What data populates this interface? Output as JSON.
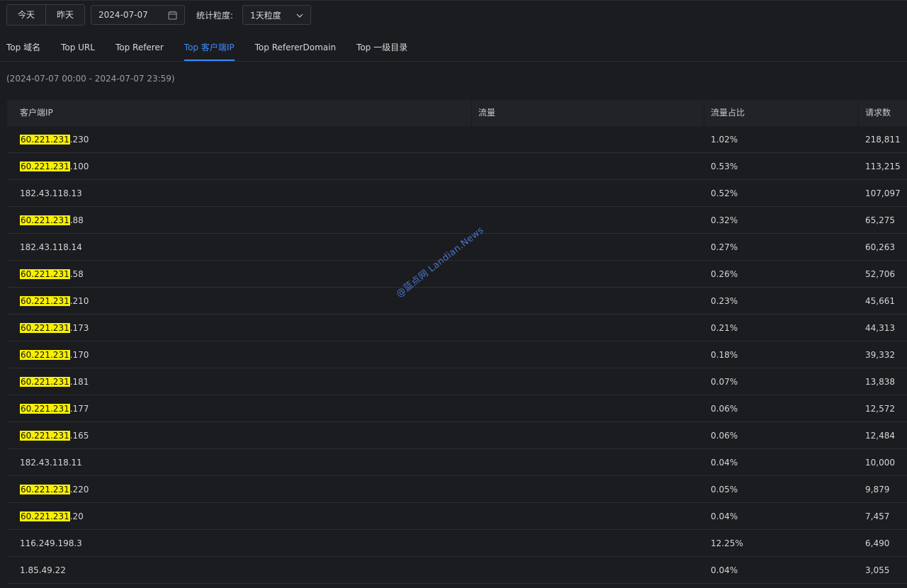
{
  "toolbar": {
    "today_label": "今天",
    "yesterday_label": "昨天",
    "date_value": "2024-07-07",
    "granularity_label": "统计粒度:",
    "granularity_value": "1天粒度"
  },
  "tabs": [
    {
      "label": "Top 域名",
      "active": false
    },
    {
      "label": "Top URL",
      "active": false
    },
    {
      "label": "Top Referer",
      "active": false
    },
    {
      "label": "Top 客户端IP",
      "active": true
    },
    {
      "label": "Top RefererDomain",
      "active": false
    },
    {
      "label": "Top 一级目录",
      "active": false
    }
  ],
  "range_text": "(2024-07-07 00:00 - 2024-07-07 23:59)",
  "table": {
    "headers": {
      "ip": "客户端IP",
      "flow": "流量",
      "pct": "流量占比",
      "req": "请求数"
    },
    "rows": [
      {
        "ip_prefix": "60.221.231",
        "ip_suffix": ".230",
        "flow": "",
        "pct": "1.02%",
        "req": "218,811"
      },
      {
        "ip_prefix": "60.221.231",
        "ip_suffix": ".100",
        "flow": "",
        "pct": "0.53%",
        "req": "113,215"
      },
      {
        "ip_prefix": "",
        "ip_suffix": "182.43.118.13",
        "flow": "",
        "pct": "0.52%",
        "req": "107,097"
      },
      {
        "ip_prefix": "60.221.231",
        "ip_suffix": ".88",
        "flow": "",
        "pct": "0.32%",
        "req": "65,275"
      },
      {
        "ip_prefix": "",
        "ip_suffix": "182.43.118.14",
        "flow": "",
        "pct": "0.27%",
        "req": "60,263"
      },
      {
        "ip_prefix": "60.221.231",
        "ip_suffix": ".58",
        "flow": "",
        "pct": "0.26%",
        "req": "52,706"
      },
      {
        "ip_prefix": "60.221.231",
        "ip_suffix": ".210",
        "flow": "",
        "pct": "0.23%",
        "req": "45,661"
      },
      {
        "ip_prefix": "60.221.231",
        "ip_suffix": ".173",
        "flow": "",
        "pct": "0.21%",
        "req": "44,313"
      },
      {
        "ip_prefix": "60.221.231",
        "ip_suffix": ".170",
        "flow": "",
        "pct": "0.18%",
        "req": "39,332"
      },
      {
        "ip_prefix": "60.221.231",
        "ip_suffix": ".181",
        "flow": "",
        "pct": "0.07%",
        "req": "13,838"
      },
      {
        "ip_prefix": "60.221.231",
        "ip_suffix": ".177",
        "flow": "",
        "pct": "0.06%",
        "req": "12,572"
      },
      {
        "ip_prefix": "60.221.231",
        "ip_suffix": ".165",
        "flow": "",
        "pct": "0.06%",
        "req": "12,484"
      },
      {
        "ip_prefix": "",
        "ip_suffix": "182.43.118.11",
        "flow": "",
        "pct": "0.04%",
        "req": "10,000"
      },
      {
        "ip_prefix": "60.221.231",
        "ip_suffix": ".220",
        "flow": "",
        "pct": "0.05%",
        "req": "9,879"
      },
      {
        "ip_prefix": "60.221.231",
        "ip_suffix": ".20",
        "flow": "",
        "pct": "0.04%",
        "req": "7,457"
      },
      {
        "ip_prefix": "",
        "ip_suffix": "116.249.198.3",
        "flow": "",
        "pct": "12.25%",
        "req": "6,490"
      },
      {
        "ip_prefix": "",
        "ip_suffix": "1.85.49.22",
        "flow": "",
        "pct": "0.04%",
        "req": "3,055"
      }
    ]
  },
  "watermark": "@蓝点网 Landian.News",
  "colors": {
    "accent": "#3d8bff",
    "highlight": "#f8f000",
    "background": "#1b1c1f"
  },
  "icons": {
    "date": "calendar-icon",
    "select": "chevron-down-icon"
  }
}
